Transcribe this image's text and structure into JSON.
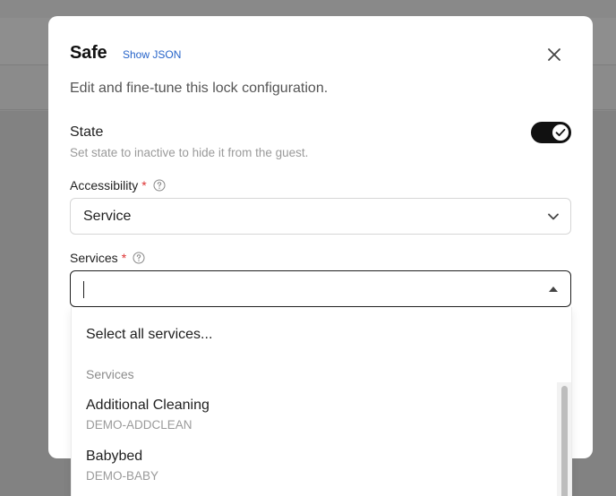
{
  "modal": {
    "title": "Safe",
    "show_json_label": "Show JSON",
    "subtitle": "Edit and fine-tune this lock configuration."
  },
  "state": {
    "label": "State",
    "help": "Set state to inactive to hide it from the guest.",
    "enabled": true
  },
  "accessibility": {
    "label": "Accessibility",
    "required_mark": "*",
    "value": "Service"
  },
  "services": {
    "label": "Services",
    "required_mark": "*",
    "input_value": ""
  },
  "dropdown": {
    "select_all_label": "Select all services...",
    "group_label": "Services",
    "options": [
      {
        "name": "Additional Cleaning",
        "code": "DEMO-ADDCLEAN"
      },
      {
        "name": "Babybed",
        "code": "DEMO-BABY"
      }
    ]
  },
  "colors": {
    "accent_link": "#2563c9",
    "required": "#dd3333",
    "toggle_on": "#111111"
  },
  "icons": {
    "close": "close-icon",
    "help": "question-circle-icon",
    "chevron": "chevron-down-icon",
    "check": "check-icon",
    "caret_up": "caret-up-icon"
  }
}
